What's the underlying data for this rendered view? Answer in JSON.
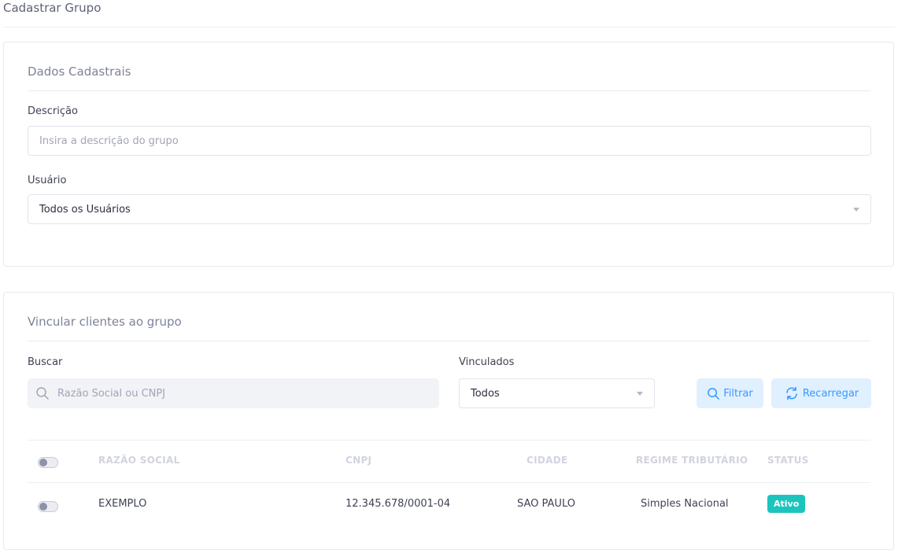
{
  "page": {
    "title": "Cadastrar Grupo"
  },
  "dados_cadastrais": {
    "title": "Dados Cadastrais",
    "descricao": {
      "label": "Descrição",
      "placeholder": "Insira a descrição do grupo",
      "value": ""
    },
    "usuario": {
      "label": "Usuário",
      "selected": "Todos os Usuários"
    }
  },
  "vincular": {
    "title": "Vincular clientes ao grupo",
    "buscar": {
      "label": "Buscar",
      "placeholder": "Razão Social ou CNPJ",
      "icon": "search-icon"
    },
    "vinculados": {
      "label": "Vinculados",
      "selected": "Todos"
    },
    "buttons": {
      "filtrar": {
        "label": "Filtrar",
        "icon": "search-icon"
      },
      "recarregar": {
        "label": "Recarregar",
        "icon": "refresh-icon"
      }
    },
    "table": {
      "columns": [
        "RAZÃO SOCIAL",
        "CNPJ",
        "CIDADE",
        "REGIME TRIBUTÁRIO",
        "STATUS"
      ],
      "rows": [
        {
          "razao_social": "EXEMPLO",
          "cnpj": "12.345.678/0001-04",
          "cidade": "SAO PAULO",
          "regime": "Simples Nacional",
          "status": "Ativo",
          "selected": false
        }
      ],
      "select_all": false
    }
  },
  "colors": {
    "accent": "#3699ff",
    "accent_bg": "#e1f0ff",
    "status_active": "#1bc5bd"
  }
}
